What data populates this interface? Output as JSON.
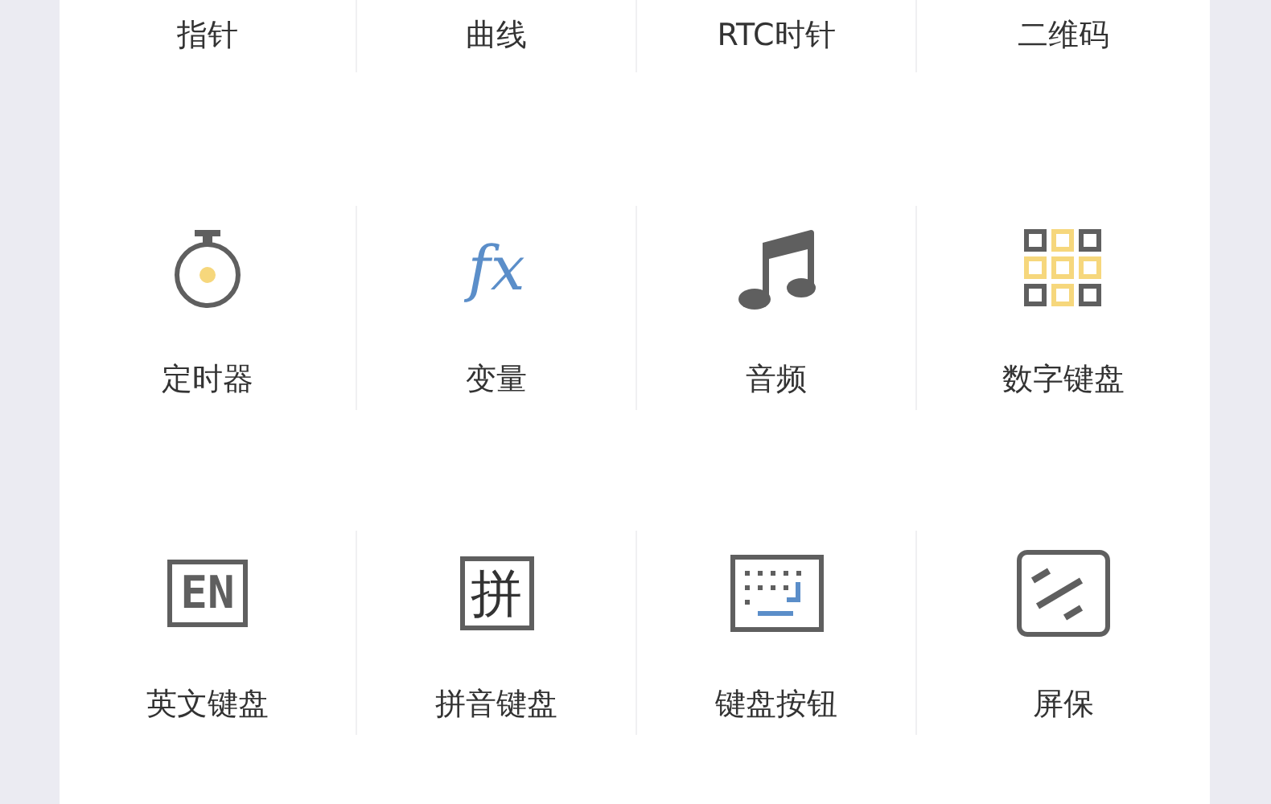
{
  "rows": [
    {
      "items": [
        {
          "label": "指针"
        },
        {
          "label": "曲线"
        },
        {
          "label": "RTC时针"
        },
        {
          "label": "二维码"
        }
      ]
    },
    {
      "items": [
        {
          "kind": "timer",
          "label": "定时器"
        },
        {
          "kind": "variable",
          "glyph": "fx",
          "label": "变量"
        },
        {
          "kind": "music",
          "label": "音频"
        },
        {
          "kind": "keypad",
          "label": "数字键盘"
        }
      ]
    },
    {
      "items": [
        {
          "kind": "english",
          "glyph": "EN",
          "label": "英文键盘"
        },
        {
          "kind": "pinyin",
          "glyph": "拼",
          "label": "拼音键盘"
        },
        {
          "kind": "keyboard",
          "label": "键盘按钮"
        },
        {
          "kind": "screensaver",
          "label": "屏保"
        }
      ]
    }
  ]
}
